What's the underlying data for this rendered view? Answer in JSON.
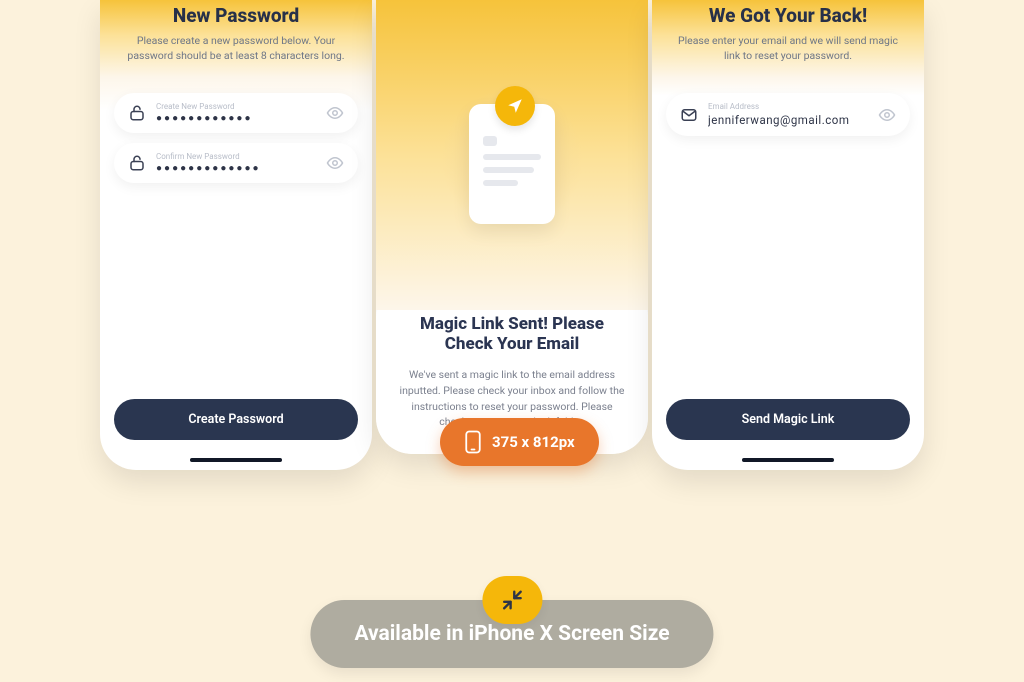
{
  "screens": {
    "newPassword": {
      "title": "New Password",
      "subtitle": "Please create a new password below. Your password should be at least 8 characters long.",
      "fields": {
        "create": {
          "label": "Create New Password",
          "masked": "●●●●●●●●●●●●"
        },
        "confirm": {
          "label": "Confirm New Password",
          "masked": "●●●●●●●●●●●●●"
        }
      },
      "cta": "Create Password"
    },
    "magicSent": {
      "heading": "Magic Link Sent! Please Check Your Email",
      "body": "We've sent a magic link to the email address inputted. Please check your inbox and follow the instructions to reset your password. Please check your spam or junk folder."
    },
    "forgot": {
      "title": "We Got Your Back!",
      "subtitle": "Please enter your email and we will send magic link to reset your password.",
      "email": {
        "label": "Email Address",
        "value": "jenniferwang@gmail.com"
      },
      "cta": "Send Magic Link"
    }
  },
  "sizePill": "375 x 812px",
  "caption": "Available in iPhone X Screen Size"
}
